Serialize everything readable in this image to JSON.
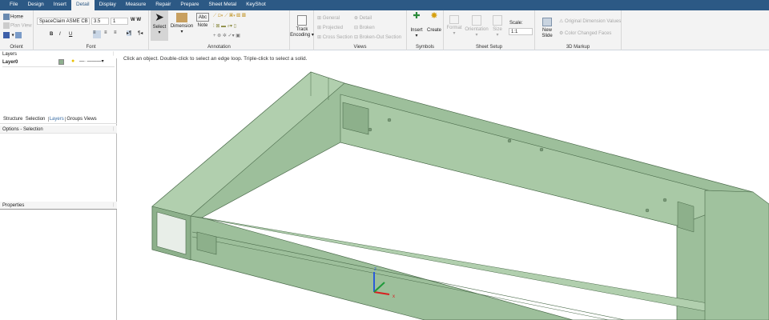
{
  "tabs": [
    "File",
    "Design",
    "Insert",
    "Detail",
    "Display",
    "Measure",
    "Repair",
    "Prepare",
    "Sheet Metal",
    "KeyShot"
  ],
  "active_tab": "Detail",
  "orient": {
    "home": "Home",
    "plan_view": "Plan View",
    "label": "Orient"
  },
  "font": {
    "family": "SpaceClaim ASME CB",
    "size": "3.5",
    "scale": "1",
    "label": "Font",
    "bold": "B",
    "italic": "I",
    "underline": "U"
  },
  "annotation": {
    "select": "Select",
    "dimension": "Dimension",
    "note": "Note",
    "note_icon": "Abc",
    "label": "Annotation"
  },
  "track": {
    "label": "Track Encoding"
  },
  "views": {
    "items": [
      "General",
      "Projected",
      "Cross Section",
      "Detail",
      "Broken",
      "Broken-Out Section"
    ],
    "label": "Views"
  },
  "symbols": {
    "insert": "Insert",
    "create": "Create",
    "label": "Symbols"
  },
  "sheet_setup": {
    "format": "Format",
    "orientation": "Orientation",
    "size": "Size",
    "scale_label": "Scale:",
    "scale_value": "1:1",
    "label": "Sheet Setup"
  },
  "markup": {
    "new_slide": "New Slide",
    "original": "Original Dimension Values",
    "color_changed": "Color Changed Faces",
    "label": "3D Markup"
  },
  "layers": {
    "title": "Layers",
    "layer": "Layer0",
    "color": "#8fb08f"
  },
  "panel_tabs": [
    "Structure",
    "Selection",
    "Layers",
    "Groups",
    "Views"
  ],
  "active_panel_tab": "Layers",
  "options_title": "Options - Selection",
  "properties_title": "Properties",
  "hint": "Click an object. Double-click to select an edge loop. Triple-click to select a solid.",
  "triad": {
    "z": "z",
    "x": "x"
  },
  "model_color": "#9dbf9b"
}
